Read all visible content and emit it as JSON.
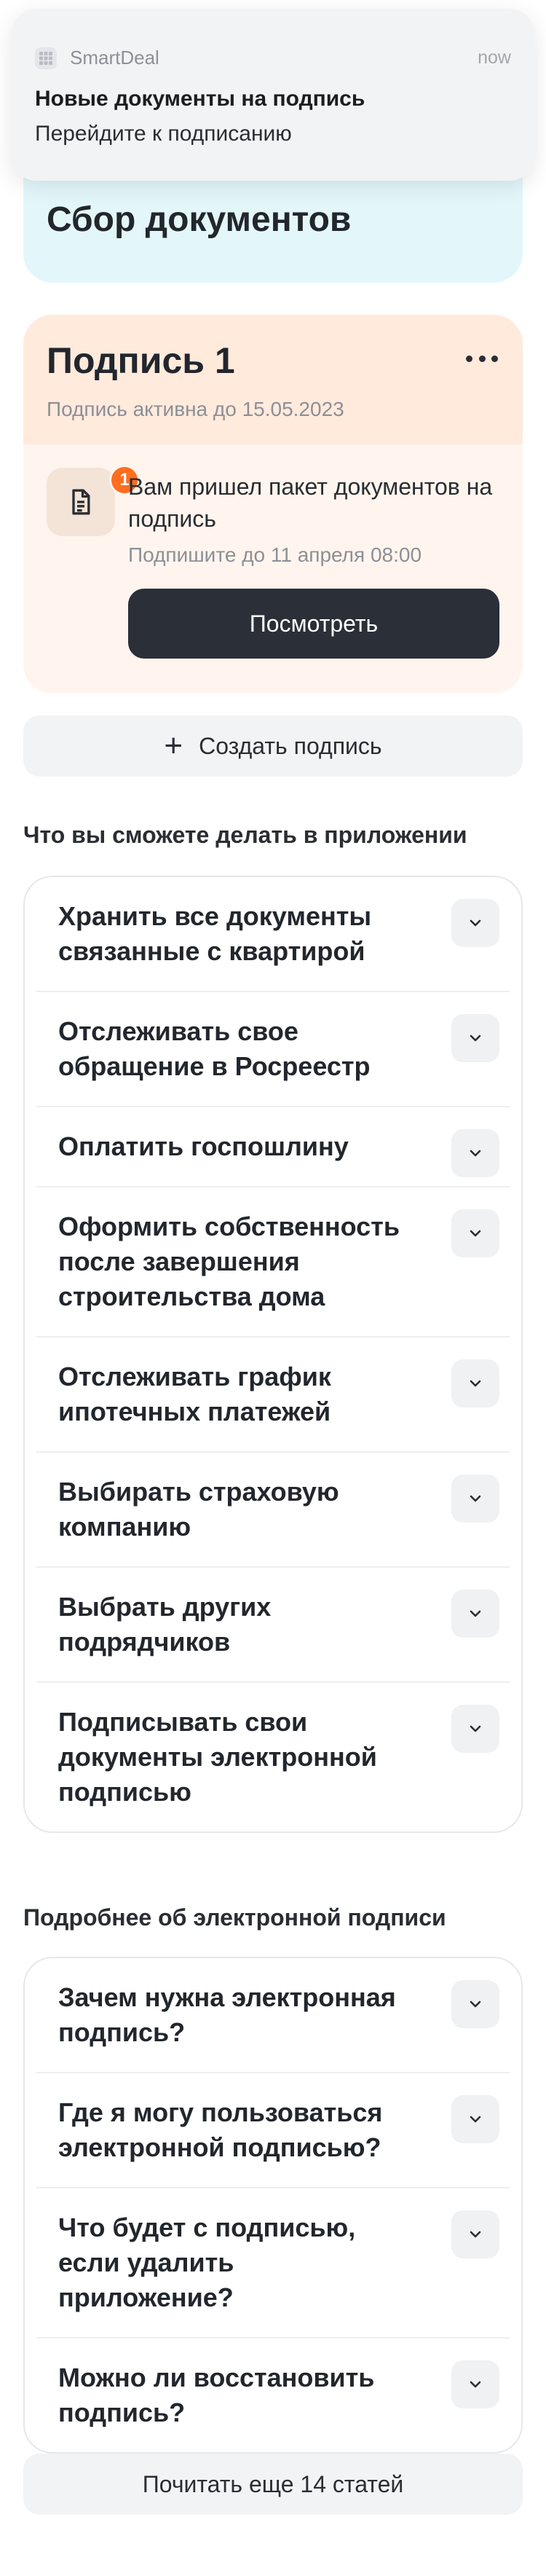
{
  "notification": {
    "app_name": "SmartDeal",
    "time": "now",
    "title": "Новые документы на подпись",
    "body": "Перейдите к подписанию"
  },
  "top_card": {
    "title": "Сбор документов"
  },
  "signature_card": {
    "title": "Подпись 1",
    "subtitle": "Подпись активна до 15.05.2023",
    "badge_count": "1",
    "message": "Вам пришел пакет документов на подпись",
    "deadline": "Подпишите до 11 апреля 08:00",
    "view_button": "Посмотреть"
  },
  "create_button": "Создать подпись",
  "features": {
    "title": "Что вы сможете делать в приложении",
    "items": [
      "Хранить все документы связанные с квартирой",
      "Отслеживать свое обращение в Росреестр",
      "Оплатить госпошлину",
      "Оформить собственность после завершения строительства дома",
      "Отслеживать график ипотечных платежей",
      "Выбирать страховую компанию",
      "Выбрать других подрядчиков",
      "Подписывать свои документы электронной подписью"
    ]
  },
  "faq": {
    "title": "Подробнее об электронной подписи",
    "items": [
      "Зачем нужна электронная подпись?",
      "Где я могу пользоваться электронной подписью?",
      "Что будет с подписью, если удалить приложение?",
      "Можно ли восстановить подпись?"
    ]
  },
  "more_button": "Почитать еще 14 статей",
  "colors": {
    "signature_bg": "#fff5ee",
    "signature_header": "#ffeadc",
    "top_card_bg": "#e3f7fb",
    "badge": "#ff6d1f",
    "primary_button": "#2a2f38"
  }
}
